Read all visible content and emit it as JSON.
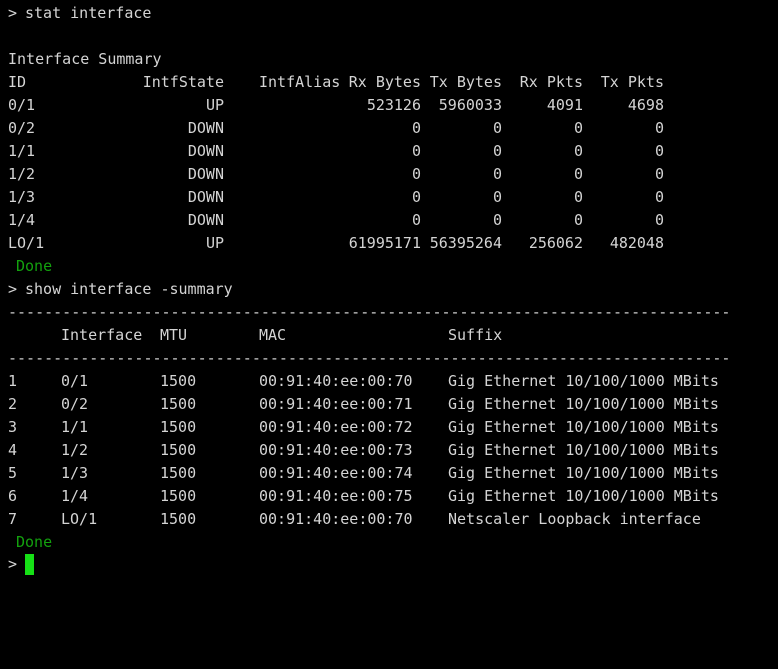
{
  "prompt_symbol": ">",
  "command_1": "stat interface",
  "summary_title": "Interface Summary",
  "stat_headers": {
    "id": "ID",
    "state": "IntfState",
    "alias": "IntfAlias",
    "rx_bytes": "Rx Bytes",
    "tx_bytes": "Tx Bytes",
    "rx_pkts": "Rx Pkts",
    "tx_pkts": "Tx Pkts"
  },
  "stat_rows": [
    {
      "id": "0/1",
      "state": "UP",
      "rx_bytes": "523126",
      "tx_bytes": "5960033",
      "rx_pkts": "4091",
      "tx_pkts": "4698"
    },
    {
      "id": "0/2",
      "state": "DOWN",
      "rx_bytes": "0",
      "tx_bytes": "0",
      "rx_pkts": "0",
      "tx_pkts": "0"
    },
    {
      "id": "1/1",
      "state": "DOWN",
      "rx_bytes": "0",
      "tx_bytes": "0",
      "rx_pkts": "0",
      "tx_pkts": "0"
    },
    {
      "id": "1/2",
      "state": "DOWN",
      "rx_bytes": "0",
      "tx_bytes": "0",
      "rx_pkts": "0",
      "tx_pkts": "0"
    },
    {
      "id": "1/3",
      "state": "DOWN",
      "rx_bytes": "0",
      "tx_bytes": "0",
      "rx_pkts": "0",
      "tx_pkts": "0"
    },
    {
      "id": "1/4",
      "state": "DOWN",
      "rx_bytes": "0",
      "tx_bytes": "0",
      "rx_pkts": "0",
      "tx_pkts": "0"
    },
    {
      "id": "LO/1",
      "state": "UP",
      "rx_bytes": "61995171",
      "tx_bytes": "56395264",
      "rx_pkts": "256062",
      "tx_pkts": "482048"
    }
  ],
  "done_text": "Done",
  "command_2": "show interface -summary",
  "separator": "--------------------------------------------------------------------------------",
  "summary_headers": {
    "interface": "Interface",
    "mtu": "MTU",
    "mac": "MAC",
    "suffix": "Suffix"
  },
  "summary_rows": [
    {
      "num": "1",
      "interface": "0/1",
      "mtu": "1500",
      "mac": "00:91:40:ee:00:70",
      "suffix": "Gig Ethernet 10/100/1000 MBits"
    },
    {
      "num": "2",
      "interface": "0/2",
      "mtu": "1500",
      "mac": "00:91:40:ee:00:71",
      "suffix": "Gig Ethernet 10/100/1000 MBits"
    },
    {
      "num": "3",
      "interface": "1/1",
      "mtu": "1500",
      "mac": "00:91:40:ee:00:72",
      "suffix": "Gig Ethernet 10/100/1000 MBits"
    },
    {
      "num": "4",
      "interface": "1/2",
      "mtu": "1500",
      "mac": "00:91:40:ee:00:73",
      "suffix": "Gig Ethernet 10/100/1000 MBits"
    },
    {
      "num": "5",
      "interface": "1/3",
      "mtu": "1500",
      "mac": "00:91:40:ee:00:74",
      "suffix": "Gig Ethernet 10/100/1000 MBits"
    },
    {
      "num": "6",
      "interface": "1/4",
      "mtu": "1500",
      "mac": "00:91:40:ee:00:75",
      "suffix": "Gig Ethernet 10/100/1000 MBits"
    },
    {
      "num": "7",
      "interface": "LO/1",
      "mtu": "1500",
      "mac": "00:91:40:ee:00:70",
      "suffix": "Netscaler Loopback interface"
    }
  ],
  "colors": {
    "background": "#000000",
    "text": "#d4d4d4",
    "done": "#13a10e",
    "cursor": "#16e016"
  }
}
